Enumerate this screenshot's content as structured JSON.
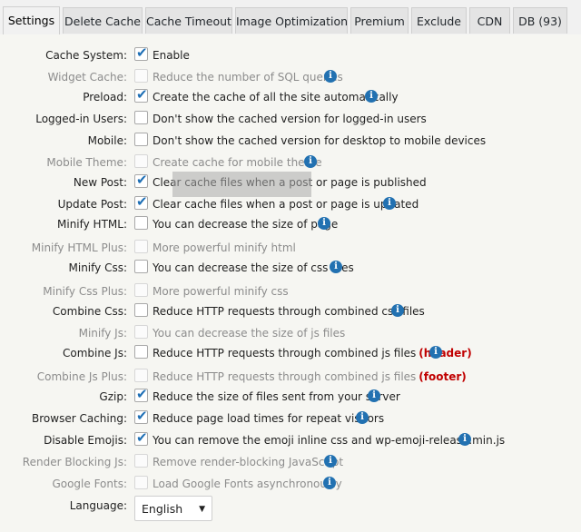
{
  "tabs": [
    "Settings",
    "Delete Cache",
    "Cache Timeout",
    "Image Optimization",
    "Premium",
    "Exclude",
    "CDN",
    "DB (93)"
  ],
  "active_tab": "Settings",
  "settings": [
    {
      "label": "Cache System:",
      "desc": "Enable",
      "checked": true,
      "disabled": false,
      "info": false
    },
    {
      "label": "Widget Cache:",
      "desc": "Reduce the number of SQL queries",
      "checked": false,
      "disabled": true,
      "info": true
    },
    {
      "label": "Preload:",
      "desc": "Create the cache of all the site automatically",
      "checked": true,
      "disabled": false,
      "info": true
    },
    {
      "label": "Logged-in Users:",
      "desc": "Don't show the cached version for logged-in users",
      "checked": false,
      "disabled": false,
      "info": false
    },
    {
      "label": "Mobile:",
      "desc": "Don't show the cached version for desktop to mobile devices",
      "checked": false,
      "disabled": false,
      "info": false
    },
    {
      "label": "Mobile Theme:",
      "desc": "Create cache for mobile theme",
      "checked": false,
      "disabled": true,
      "info": true
    },
    {
      "label": "New Post:",
      "desc": "Clear cache files when a post or page is published",
      "checked": true,
      "disabled": false,
      "info": false
    },
    {
      "label": "Update Post:",
      "desc": "Clear cache files when a post or page is updated",
      "checked": true,
      "disabled": false,
      "info": true
    },
    {
      "label": "Minify HTML:",
      "desc": "You can decrease the size of page",
      "checked": false,
      "disabled": false,
      "info": true
    },
    {
      "label": "Minify HTML Plus:",
      "desc": "More powerful minify html",
      "checked": false,
      "disabled": true,
      "info": false
    },
    {
      "label": "Minify Css:",
      "desc": "You can decrease the size of css files",
      "checked": false,
      "disabled": false,
      "info": true
    },
    {
      "label": "Minify Css Plus:",
      "desc": "More powerful minify css",
      "checked": false,
      "disabled": true,
      "info": false
    },
    {
      "label": "Combine Css:",
      "desc": "Reduce HTTP requests through combined css files",
      "checked": false,
      "disabled": false,
      "info": true
    },
    {
      "label": "Minify Js:",
      "desc": "You can decrease the size of js files",
      "checked": false,
      "disabled": true,
      "info": false
    },
    {
      "label": "Combine Js:",
      "desc": "Reduce HTTP requests through combined js files",
      "note": "(header)",
      "checked": false,
      "disabled": false,
      "info": true
    },
    {
      "label": "Combine Js Plus:",
      "desc": "Reduce HTTP requests through combined js files",
      "note": "(footer)",
      "checked": false,
      "disabled": true,
      "info": false
    },
    {
      "label": "Gzip:",
      "desc": "Reduce the size of files sent from your server",
      "checked": true,
      "disabled": false,
      "info": true
    },
    {
      "label": "Browser Caching:",
      "desc": "Reduce page load times for repeat visitors",
      "checked": true,
      "disabled": false,
      "info": true
    },
    {
      "label": "Disable Emojis:",
      "desc": "You can remove the emoji inline css and wp-emoji-release.min.js",
      "checked": true,
      "disabled": false,
      "info": true
    },
    {
      "label": "Render Blocking Js:",
      "desc": "Remove render-blocking JavaScript",
      "checked": false,
      "disabled": true,
      "info": true
    },
    {
      "label": "Google Fonts:",
      "desc": "Load Google Fonts asynchronously",
      "checked": false,
      "disabled": true,
      "info": true
    }
  ],
  "language": {
    "label": "Language:",
    "value": "English"
  },
  "colors": {
    "accent": "#2271b1",
    "note": "#c00000",
    "check": "#1e6fb5"
  }
}
